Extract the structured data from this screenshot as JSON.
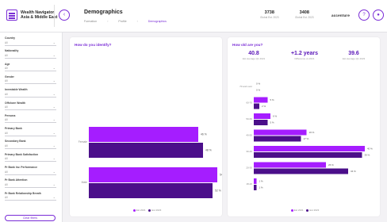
{
  "header": {
    "brand_line1": "Wealth Navigator",
    "brand_line2": "Asia & Middle East",
    "page_title": "Demographics",
    "breadcrumbs": [
      {
        "label": "Formation",
        "active": false
      },
      {
        "label": "Profile",
        "active": false
      },
      {
        "label": "Demographics",
        "active": true
      }
    ],
    "stats": [
      {
        "value": "3738",
        "label": "Global Est. 2023"
      },
      {
        "value": "3408",
        "label": "Global Est. 2023"
      }
    ],
    "logo_text": "accenture",
    "icons": [
      "menu-icon",
      "arrow-left-icon",
      "help-icon",
      "user-icon"
    ]
  },
  "sidebar": {
    "filters": [
      {
        "label": "Country",
        "value": "All"
      },
      {
        "label": "Nationality",
        "value": "All"
      },
      {
        "label": "Age",
        "value": "All"
      },
      {
        "label": "Gender",
        "value": "All"
      },
      {
        "label": "Investable Wealth",
        "value": "All"
      },
      {
        "label": "Offshore Wealth",
        "value": "All"
      },
      {
        "label": "Persona",
        "value": "All"
      },
      {
        "label": "Primary Bank",
        "value": "All"
      },
      {
        "label": "Secondary Bank",
        "value": "All"
      },
      {
        "label": "Primary Bank Satisfaction",
        "value": "All"
      },
      {
        "label": "Pr Bank Inv. Performance",
        "value": "All"
      },
      {
        "label": "Pr Bank Attention",
        "value": "All"
      },
      {
        "label": "Pr Bank Relationship Breath",
        "value": "All"
      }
    ],
    "clear_label": "Clear filters"
  },
  "colors": {
    "accent": "#7a2dd6",
    "series_2021": "#a51dff",
    "series_2023": "#4b0f8a"
  },
  "gender_panel": {
    "title": "How do you identify?",
    "legend": [
      "Est 2021",
      "Est 2023"
    ],
    "chart_data": {
      "type": "bar",
      "orientation": "horizontal",
      "categories": [
        "Female",
        "Male"
      ],
      "series": [
        {
          "name": "Est 2021",
          "values": [
            46,
            54
          ]
        },
        {
          "name": "Est 2023",
          "values": [
            48,
            52
          ]
        }
      ],
      "value_suffix": "%"
    }
  },
  "age_panel": {
    "title": "How old are you?",
    "kpis": [
      {
        "value": "40.8",
        "label": "Est average Q1 2021"
      },
      {
        "value": "+1.2 years",
        "label": "Difference vs 2021"
      },
      {
        "value": "39.6",
        "label": "Est average Q1 2023"
      }
    ],
    "legend": [
      "Est 2021",
      "Est 2023"
    ],
    "chart_data": {
      "type": "bar",
      "orientation": "horizontal",
      "categories": [
        "70 and over",
        "60-70",
        "50-60",
        "40-50",
        "30-40",
        "20-30",
        "18-20"
      ],
      "series": [
        {
          "name": "Est 2021",
          "values": [
            0,
            5,
            6,
            19,
            40,
            26,
            1
          ]
        },
        {
          "name": "Est 2023",
          "values": [
            0,
            2,
            5,
            17,
            39,
            34,
            1
          ]
        }
      ],
      "value_suffix": "%"
    }
  }
}
